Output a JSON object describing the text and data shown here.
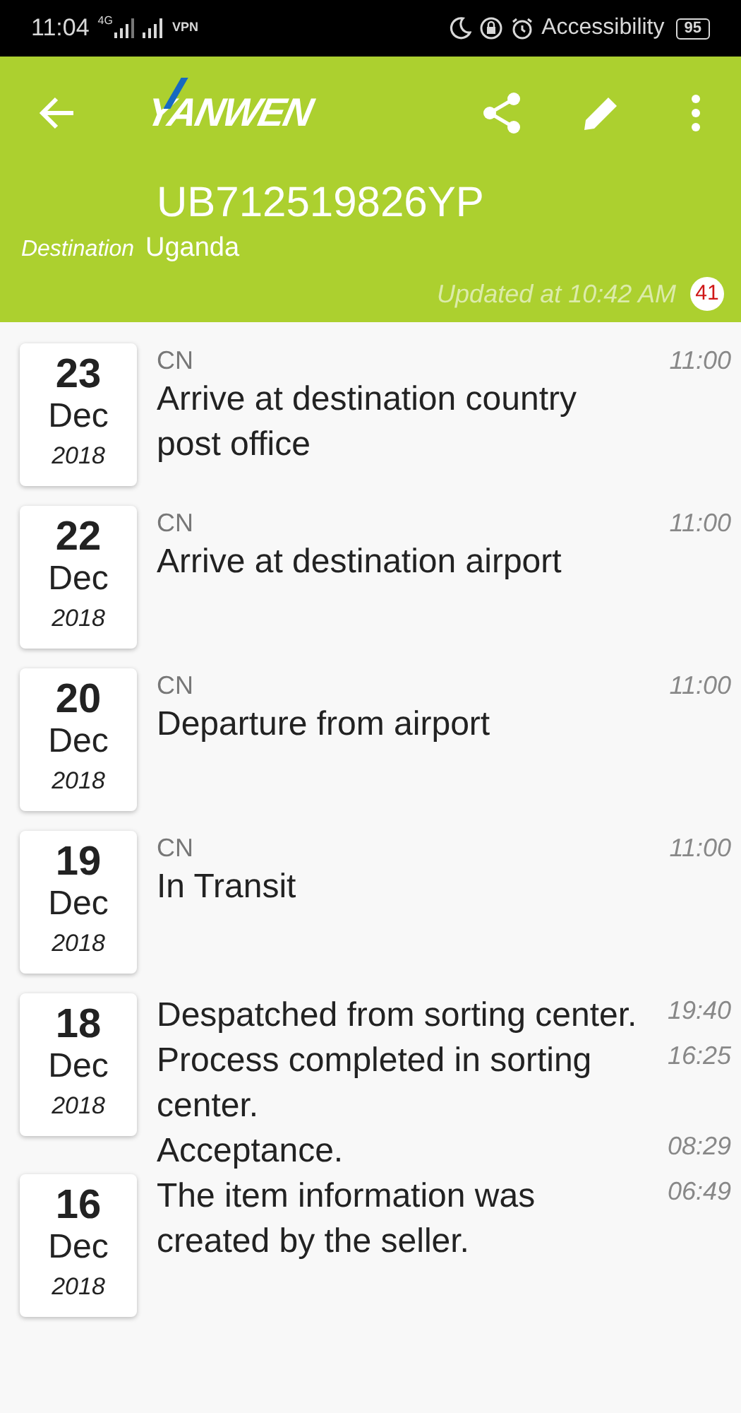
{
  "status_bar": {
    "time": "11:04",
    "network": "4G",
    "vpn": "VPN",
    "accessibility": "Accessibility",
    "battery": "95"
  },
  "header": {
    "logo": "YANWEN",
    "tracking_number": "UB712519826YP",
    "destination_label": "Destination",
    "destination": "Uganda",
    "updated": "Updated at 10:42 AM",
    "badge": "41"
  },
  "days": [
    {
      "day": "23",
      "month": "Dec",
      "year": "2018",
      "events": [
        {
          "origin": "CN",
          "text": "Arrive at destination country post office",
          "time": "11:00"
        }
      ]
    },
    {
      "day": "22",
      "month": "Dec",
      "year": "2018",
      "events": [
        {
          "origin": "CN",
          "text": "Arrive at destination airport",
          "time": "11:00"
        }
      ]
    },
    {
      "day": "20",
      "month": "Dec",
      "year": "2018",
      "events": [
        {
          "origin": "CN",
          "text": "Departure from airport",
          "time": "11:00"
        }
      ]
    },
    {
      "day": "19",
      "month": "Dec",
      "year": "2018",
      "events": [
        {
          "origin": "CN",
          "text": "In Transit",
          "time": "11:00"
        }
      ]
    },
    {
      "day": "18",
      "month": "Dec",
      "year": "2018",
      "events": [
        {
          "text": "Despatched from sorting center.",
          "time": "19:40"
        },
        {
          "text": "Process completed in sorting center.",
          "time": "16:25"
        },
        {
          "text": "Acceptance.",
          "time": "08:29"
        }
      ]
    },
    {
      "day": "16",
      "month": "Dec",
      "year": "2018",
      "events": [
        {
          "text": "The item information was created by the seller.",
          "time": "06:49"
        }
      ]
    }
  ]
}
